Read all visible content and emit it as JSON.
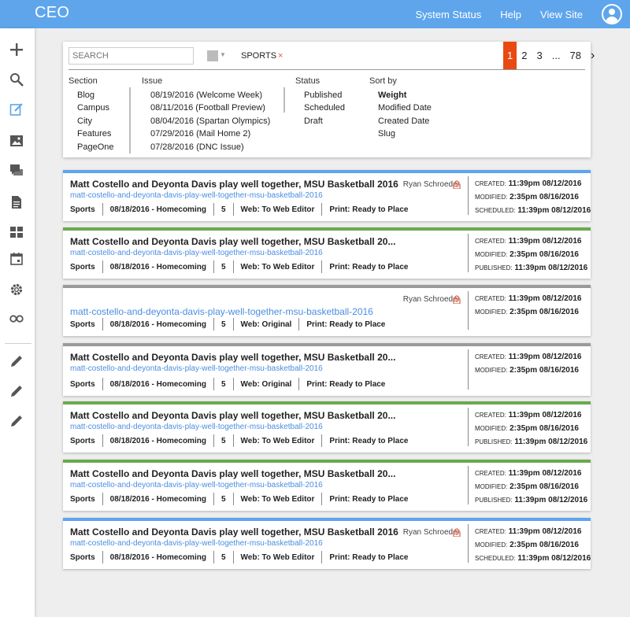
{
  "app": {
    "title": "CEO"
  },
  "topnav": {
    "items": [
      "System Status",
      "Help",
      "View Site"
    ]
  },
  "sidebar": {
    "icons": [
      "plus-icon",
      "search-icon",
      "edit-icon",
      "image-icon",
      "comments-icon",
      "document-icon",
      "grid-icon",
      "calendar-icon",
      "gear-icon",
      "infinity-icon",
      "pencil-icon",
      "pencil-icon",
      "pencil-icon"
    ]
  },
  "filter": {
    "search_placeholder": "SEARCH",
    "tag": "SPORTS",
    "tag_remove": "×",
    "pages": [
      "1",
      "2",
      "3",
      "...",
      "78"
    ],
    "next": "›",
    "section": {
      "label": "Section",
      "options": [
        "Blog",
        "Campus",
        "City",
        "Features",
        "PageOne"
      ]
    },
    "issue": {
      "label": "Issue",
      "options": [
        "08/19/2016 (Welcome Week)",
        "08/11/2016 (Football Preview)",
        "08/04/2016 (Spartan Olympics)",
        "07/29/2016 (Mail Home 2)",
        "07/28/2016 (DNC Issue)"
      ]
    },
    "status": {
      "label": "Status",
      "options": [
        "Published",
        "Scheduled",
        "Draft"
      ]
    },
    "sort": {
      "label": "Sort by",
      "options": [
        "Weight",
        "Modified Date",
        "Created Date",
        "Slug"
      ],
      "selected": "Weight"
    }
  },
  "colors": {
    "blue": "#5ea5ec",
    "green": "#6aaa4e",
    "gray": "#9a9a9a",
    "accent": "#e84a12"
  },
  "stories": [
    {
      "bar": "blue",
      "title": "Matt Costello and Deyonta Davis play well together, MSU Basketball 2016",
      "slug": "matt-costello-and-deyonta-davis-play-well-together-msu-basketball-2016",
      "author": "Ryan Schroeder",
      "locked": true,
      "section": "Sports",
      "issue": "08/18/2016 - Homecoming",
      "page": "5",
      "web": "Web: To Web Editor",
      "print": "Print: Ready to Place",
      "dates": [
        {
          "label": "CREATED:",
          "value": "11:39pm 08/12/2016"
        },
        {
          "label": "MODIFIED:",
          "value": "2:35pm 08/16/2016"
        },
        {
          "label": "SCHEDULED:",
          "value": "11:39pm 08/12/2016"
        }
      ]
    },
    {
      "bar": "green",
      "title": "Matt Costello and Deyonta Davis play well together, MSU Basketball 20...",
      "slug": "matt-costello-and-deyonta-davis-play-well-together-msu-basketball-2016",
      "author": "",
      "locked": false,
      "section": "Sports",
      "issue": "08/18/2016 - Homecoming",
      "page": "5",
      "web": "Web: To Web Editor",
      "print": "Print: Ready to Place",
      "dates": [
        {
          "label": "CREATED:",
          "value": "11:39pm 08/12/2016"
        },
        {
          "label": "MODIFIED:",
          "value": "2:35pm 08/16/2016"
        },
        {
          "label": "PUBLISHED:",
          "value": "11:39pm 08/12/2016"
        }
      ]
    },
    {
      "bar": "gray",
      "title": "",
      "slug": "matt-costello-and-deyonta-davis-play-well-together-msu-basketball-2016",
      "author": "Ryan Schroeder",
      "locked": true,
      "section": "Sports",
      "issue": "08/18/2016 - Homecoming",
      "page": "5",
      "web": "Web: Original",
      "print": "Print: Ready to Place",
      "dates": [
        {
          "label": "CREATED:",
          "value": "11:39pm 08/12/2016"
        },
        {
          "label": "MODIFIED:",
          "value": "2:35pm 08/16/2016"
        }
      ]
    },
    {
      "bar": "gray",
      "title": "Matt Costello and Deyonta Davis play well together, MSU Basketball 20...",
      "slug": "matt-costello-and-deyonta-davis-play-well-together-msu-basketball-2016",
      "author": "",
      "locked": false,
      "section": "Sports",
      "issue": "08/18/2016 - Homecoming",
      "page": "5",
      "web": "Web: Original",
      "print": "Print: Ready to Place",
      "dates": [
        {
          "label": "CREATED:",
          "value": "11:39pm 08/12/2016"
        },
        {
          "label": "MODIFIED:",
          "value": "2:35pm 08/16/2016"
        }
      ]
    },
    {
      "bar": "green",
      "title": "Matt Costello and Deyonta Davis play well together, MSU Basketball 20...",
      "slug": "matt-costello-and-deyonta-davis-play-well-together-msu-basketball-2016",
      "author": "",
      "locked": false,
      "section": "Sports",
      "issue": "08/18/2016 - Homecoming",
      "page": "5",
      "web": "Web: To Web Editor",
      "print": "Print: Ready to Place",
      "dates": [
        {
          "label": "CREATED:",
          "value": "11:39pm 08/12/2016"
        },
        {
          "label": "MODIFIED:",
          "value": "2:35pm 08/16/2016"
        },
        {
          "label": "PUBLISHED:",
          "value": "11:39pm 08/12/2016"
        }
      ]
    },
    {
      "bar": "green",
      "title": "Matt Costello and Deyonta Davis play well together, MSU Basketball 20...",
      "slug": "matt-costello-and-deyonta-davis-play-well-together-msu-basketball-2016",
      "author": "",
      "locked": false,
      "section": "Sports",
      "issue": "08/18/2016 - Homecoming",
      "page": "5",
      "web": "Web: To Web Editor",
      "print": "Print: Ready to Place",
      "dates": [
        {
          "label": "CREATED:",
          "value": "11:39pm 08/12/2016"
        },
        {
          "label": "MODIFIED:",
          "value": "2:35pm 08/16/2016"
        },
        {
          "label": "PUBLISHED:",
          "value": "11:39pm 08/12/2016"
        }
      ]
    },
    {
      "bar": "blue",
      "title": "Matt Costello and Deyonta Davis play well together, MSU Basketball 2016",
      "slug": "matt-costello-and-deyonta-davis-play-well-together-msu-basketball-2016",
      "author": "Ryan Schroeder",
      "locked": true,
      "section": "Sports",
      "issue": "08/18/2016 - Homecoming",
      "page": "5",
      "web": "Web: To Web Editor",
      "print": "Print: Ready to Place",
      "dates": [
        {
          "label": "CREATED:",
          "value": "11:39pm 08/12/2016"
        },
        {
          "label": "MODIFIED:",
          "value": "2:35pm 08/16/2016"
        },
        {
          "label": "SCHEDULED:",
          "value": "11:39pm 08/12/2016"
        }
      ]
    }
  ]
}
